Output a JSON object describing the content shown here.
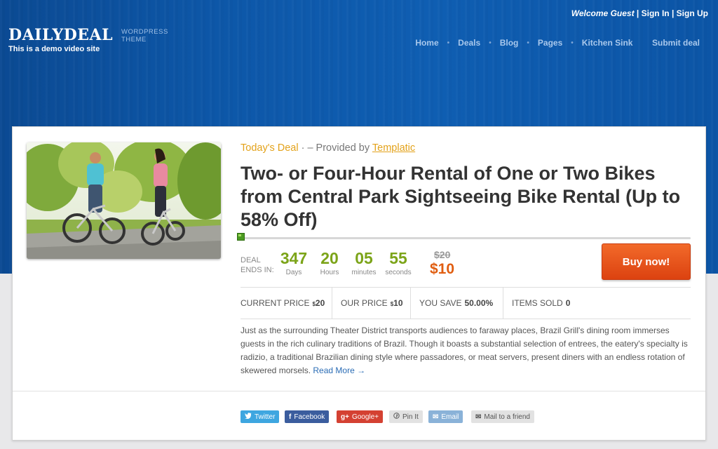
{
  "header": {
    "welcome": "Welcome Guest",
    "sep": "|",
    "signin": "Sign In",
    "signup": "Sign Up",
    "logo": "DAILYDEAL",
    "logo_sub_1": "WORDPRESS",
    "logo_sub_2": "THEME",
    "tagline": "This is a demo video site",
    "nav": [
      "Home",
      "Deals",
      "Blog",
      "Pages",
      "Kitchen Sink",
      "Submit deal"
    ]
  },
  "deal": {
    "today": "Today's Deal",
    "provided_prefix": "· – Provided by",
    "provider": "Templatic",
    "title": "Two- or Four-Hour Rental of One or Two Bikes from Central Park Sightseeing Bike Rental (Up to 58% Off)",
    "ends_1": "DEAL",
    "ends_2": "ENDS IN:",
    "countdown": [
      {
        "value": "347",
        "label": "Days"
      },
      {
        "value": "20",
        "label": "Hours"
      },
      {
        "value": "05",
        "label": "minutes"
      },
      {
        "value": "55",
        "label": "seconds"
      }
    ],
    "old_price": "$20",
    "new_price": "$10",
    "buy_label": "Buy now!",
    "stats": {
      "current_label": "CURRENT PRICE",
      "current_sym": "$",
      "current_val": "20",
      "our_label": "OUR PRICE",
      "our_sym": "$",
      "our_val": "10",
      "save_label": "YOU SAVE",
      "save_val": "50.00%",
      "sold_label": "ITEMS SOLD",
      "sold_val": "0"
    },
    "description": "Just as the surrounding Theater District transports audiences to faraway places, Brazil Grill's dining room immerses guests in the rich culinary traditions of Brazil. Though it boasts a substantial selection of entrees, the eatery's specialty is radizio, a traditional Brazilian dining style where passadores, or meat servers, present diners with an endless rotation of skewered morsels.",
    "read_more": "Read More →"
  },
  "share": [
    {
      "icon": "twitter-icon",
      "glyph": "🐦",
      "label": "Twitter",
      "color": "#3ea6e0"
    },
    {
      "icon": "facebook-icon",
      "glyph": "f",
      "label": "Facebook",
      "color": "#3b5d9e"
    },
    {
      "icon": "googleplus-icon",
      "glyph": "g+",
      "label": "Google+",
      "color": "#d44132"
    },
    {
      "icon": "pinterest-icon",
      "glyph": "℗",
      "label": "Pin It",
      "color": "#e2e2e2"
    },
    {
      "icon": "mail-icon",
      "glyph": "✉",
      "label": "Email",
      "color": "#8ab2d8"
    },
    {
      "icon": "mail-friend-icon",
      "glyph": "✉",
      "label": "Mail to a friend",
      "color": "#e2e2e2"
    }
  ]
}
